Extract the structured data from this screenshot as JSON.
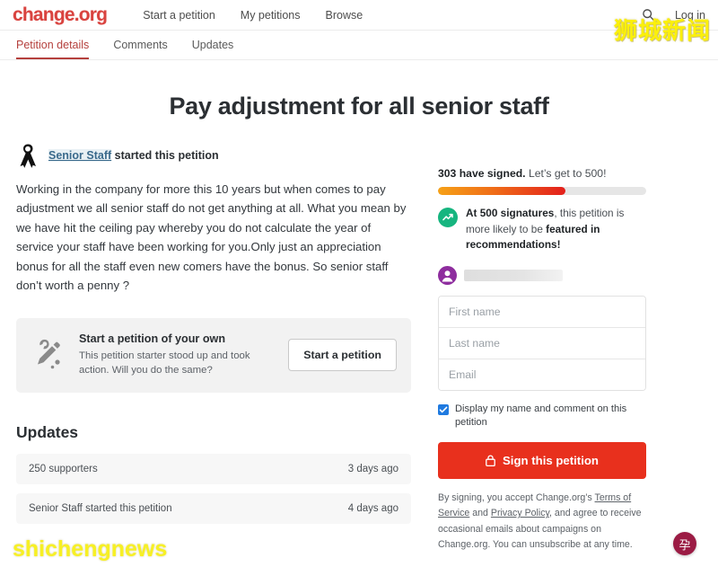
{
  "header": {
    "logo": "change.org",
    "nav_items": [
      {
        "label": "Start a petition"
      },
      {
        "label": "My petitions"
      },
      {
        "label": "Browse"
      }
    ],
    "search_icon": "search-icon",
    "login_label": "Log in"
  },
  "tabs": [
    {
      "label": "Petition details",
      "active": true
    },
    {
      "label": "Comments",
      "active": false
    },
    {
      "label": "Updates",
      "active": false
    }
  ],
  "petition": {
    "title": "Pay adjustment for all senior staff",
    "starter_icon": "ribbon-icon",
    "starter_name": "Senior Staff",
    "starter_suffix": " started this petition",
    "body": "Working in the company for more this 10 years but when comes to pay adjustment we all senior staff do not get anything at all. What you mean by we have hit the ceiling pay whereby you do not calculate the year of service your staff have been working for you.Only just an appreciation bonus for all the staff even new comers have the bonus. So senior staff don’t worth a penny ?"
  },
  "promo": {
    "icon": "pencil-icon",
    "title": "Start a petition of your own",
    "subtitle": "This petition starter stood up and took action. Will you do the same?",
    "button_label": "Start a petition"
  },
  "updates": {
    "heading": "Updates",
    "rows": [
      {
        "label": "250 supporters",
        "time": "3 days ago"
      },
      {
        "label": "Senior Staff started this petition",
        "time": "4 days ago"
      }
    ]
  },
  "sign_panel": {
    "signed_count": "303 have signed.",
    "goal_text": " Let’s get to 500!",
    "progress_percent": 61,
    "milestone_icon": "trending-up-icon",
    "milestone_prefix": "At 500 signatures",
    "milestone_body": ", this petition is more likely to be ",
    "milestone_highlight": "featured in recommendations!",
    "avatar_icon": "avatar-icon",
    "user_name_redacted": "",
    "fields": [
      {
        "name": "first-name-field",
        "placeholder": "First name",
        "value": ""
      },
      {
        "name": "last-name-field",
        "placeholder": "Last name",
        "value": ""
      },
      {
        "name": "email-field",
        "placeholder": "Email",
        "value": ""
      }
    ],
    "checkbox_checked": true,
    "checkbox_label": "Display my name and comment on this petition",
    "submit_icon": "lock-icon",
    "submit_label": "Sign this petition",
    "legal_prefix": "By signing, you accept Change.org’s ",
    "legal_link_1": "Terms of Service",
    "legal_middle": " and ",
    "legal_link_2": "Privacy Policy",
    "legal_suffix": ", and agree to receive occasional emails about campaigns on Change.org. You can unsubscribe at any time."
  },
  "watermarks": {
    "chinese": "狮城新闻",
    "english": "shichengnews",
    "badge_char": "孕"
  },
  "colors": {
    "brand_red": "#d9433f",
    "accent_red": "#e8301d",
    "tab_active": "#b5403d",
    "progress_start": "#f6a117",
    "progress_end": "#e3201c",
    "checkbox_blue": "#1f7ae0",
    "watermark_yellow": "#f7ef12",
    "badge_maroon": "#9b1b44"
  }
}
